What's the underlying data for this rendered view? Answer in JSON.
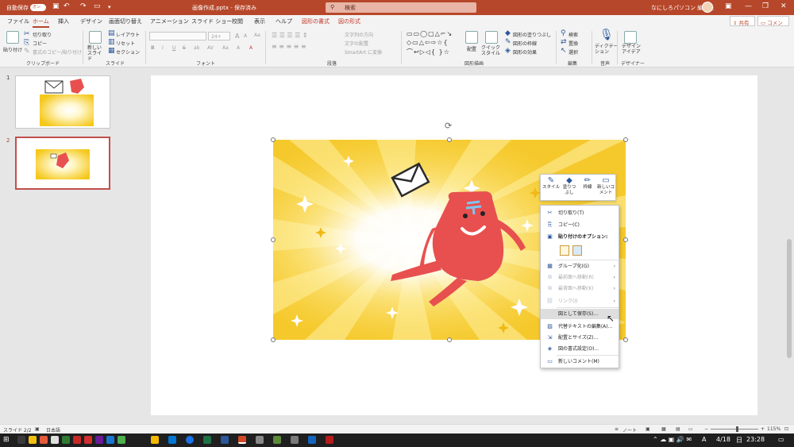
{
  "titlebar": {
    "autosave_label": "自動保存",
    "toggle": "オン",
    "filename": "画像作成.pptx - 保存済み",
    "search_placeholder": "検索",
    "user": "なにしろパソコン 編集長"
  },
  "tabs": [
    "ファイル",
    "ホーム",
    "挿入",
    "デザイン",
    "画面切り替え",
    "アニメーション",
    "スライド ショー",
    "校閲",
    "表示",
    "ヘルプ",
    "図形の書式",
    "図の形式"
  ],
  "share": "共有",
  "comment": "コメント",
  "ribbon": {
    "clipboard": {
      "paste": "貼り付け",
      "cut": "切り取り",
      "copy": "コピー",
      "format_painter": "書式のコピー/貼り付け",
      "group": "クリップボード"
    },
    "slides": {
      "new_slide": "新しい スライド",
      "layout": "レイアウト",
      "reset": "リセット",
      "section": "セクション",
      "group": "スライド"
    },
    "font": {
      "size": "24+",
      "group": "フォント",
      "format_buttons": [
        "B",
        "I",
        "U",
        "S",
        "ab",
        "AV",
        "Aa",
        "A",
        "A"
      ]
    },
    "paragraph": {
      "text_direction": "文字列の方向",
      "align_text": "文字の配置",
      "smartart": "SmartArt に変換",
      "group": "段落"
    },
    "drawing": {
      "arrange": "配置",
      "quick_styles": "クイック スタイル",
      "shape_fill": "図形の塗りつぶし",
      "shape_outline": "図形の枠線",
      "shape_effects": "図形の効果",
      "group": "図形描画"
    },
    "editing": {
      "find": "検索",
      "replace": "置換",
      "select": "選択",
      "group": "編集"
    },
    "voice": {
      "dictate": "ディクテーション",
      "group": "音声"
    },
    "designer": {
      "ideas": "デザイン アイデア",
      "group": "デザイナー"
    }
  },
  "slides_pane": [
    {
      "num": "1"
    },
    {
      "num": "2"
    }
  ],
  "mini_toolbar": [
    {
      "label": "スタイル",
      "icon": "pen-icon"
    },
    {
      "label": "塗りつぶし",
      "icon": "fill-icon"
    },
    {
      "label": "枠線",
      "icon": "outline-icon"
    },
    {
      "label": "新しいコメント",
      "icon": "comment-icon"
    }
  ],
  "context_menu": {
    "items": [
      {
        "label": "切り取り(T)",
        "icon": "scissors-icon",
        "disabled": false
      },
      {
        "label": "コピー(C)",
        "icon": "copy-icon",
        "disabled": false
      },
      {
        "label": "貼り付けのオプション:",
        "icon": "paste-icon",
        "disabled": false,
        "bold": true
      },
      {
        "label": "グループ化(G)",
        "icon": "group-icon",
        "disabled": false,
        "submenu": true
      },
      {
        "label": "最前面へ移動(R)",
        "icon": "bring-front-icon",
        "disabled": true,
        "submenu": true
      },
      {
        "label": "最背面へ移動(K)",
        "icon": "send-back-icon",
        "disabled": true,
        "submenu": true
      },
      {
        "label": "リンク(I)",
        "icon": "link-icon",
        "disabled": true,
        "submenu": true
      },
      {
        "label": "図として保存(S)...",
        "icon": "",
        "disabled": false,
        "highlighted": true
      },
      {
        "label": "代替テキストの編集(A)...",
        "icon": "alt-text-icon",
        "disabled": false
      },
      {
        "label": "配置とサイズ(Z)...",
        "icon": "size-icon",
        "disabled": false
      },
      {
        "label": "図の書式設定(O)...",
        "icon": "format-icon",
        "disabled": false
      },
      {
        "label": "新しいコメント(M)",
        "icon": "comment-icon",
        "disabled": false
      }
    ]
  },
  "statusbar": {
    "slide": "スライド 2/2",
    "language": "日本語",
    "notes": "ノート",
    "zoom": "115%"
  },
  "taskbar": {
    "ime": "A",
    "date": "4/18",
    "day": "日",
    "time": "23:28"
  },
  "colors": {
    "accent": "#b7472a",
    "sunburst": "#f5cb2f",
    "character": "#e8504f"
  }
}
